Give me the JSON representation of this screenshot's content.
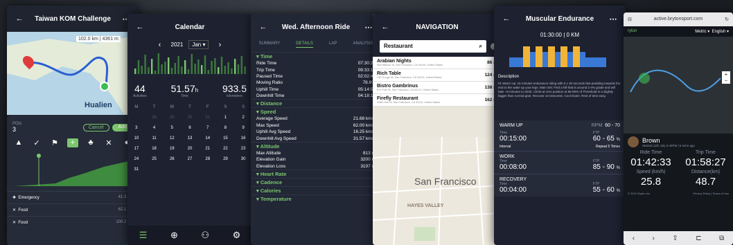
{
  "p1": {
    "title": "Taiwan KOM Challenge",
    "scale": "102.0 km",
    "elev": "4361 m",
    "place": "Hualien",
    "pois_label": "POIs",
    "pois_count": "3",
    "cancel": "Cancel",
    "add": "Add",
    "items": [
      {
        "label": "Emergency",
        "val": "41.3 km"
      },
      {
        "label": "Food",
        "val": "62.1 km"
      },
      {
        "label": "Food",
        "val": "100.2 km"
      }
    ]
  },
  "p2": {
    "title": "Calendar",
    "year": "2021",
    "month": "Jan",
    "stats": [
      {
        "v": "44",
        "l": "Activities"
      },
      {
        "v": "51.57",
        "u": "h",
        "l": "Time"
      },
      {
        "v": "933.5",
        "l": "kilometers"
      }
    ],
    "weekdays": [
      "M",
      "T",
      "W",
      "T",
      "F",
      "S",
      "S"
    ],
    "days": [
      "",
      "28",
      "29",
      "30",
      "31",
      "1",
      "2",
      "3",
      "4",
      "5",
      "6",
      "7",
      "8",
      "9",
      "10",
      "11",
      "12",
      "13",
      "14",
      "15",
      "16",
      "17",
      "18",
      "19",
      "20",
      "21",
      "22",
      "23",
      "24",
      "25",
      "26",
      "27",
      "28",
      "29",
      "30",
      "31"
    ]
  },
  "p3": {
    "title": "Wed. Afternoon Ride",
    "tabs": [
      "SUMMARY",
      "DETAILS",
      "LAP",
      "ANALYSIS"
    ],
    "sections": [
      {
        "name": "Time",
        "rows": [
          [
            "Ride Time",
            "07:30:25"
          ],
          [
            "Trip Time",
            "09:33:18"
          ],
          [
            "Paused Time",
            "02:02:43"
          ],
          [
            "Moving Ratio",
            "78.6%"
          ],
          [
            "Uphill Time",
            "05:14:57"
          ],
          [
            "Downhill Time",
            "04:18:10"
          ]
        ]
      },
      {
        "name": "Distance",
        "rows": []
      },
      {
        "name": "Speed",
        "rows": [
          [
            "Average Speed",
            "21.68 km/h"
          ],
          [
            "Max Speed",
            "62.00 km/h"
          ],
          [
            "Uphill Avg Speed",
            "16.25 km/h"
          ],
          [
            "Downhill Avg Speed",
            "31.57 km/h"
          ]
        ]
      },
      {
        "name": "Altitude",
        "rows": [
          [
            "Max Altitude",
            "813 m"
          ],
          [
            "Elevation Gain",
            "3200 m"
          ],
          [
            "Elevation Loss",
            "3197 m"
          ]
        ]
      },
      {
        "name": "Heart Rate",
        "rows": []
      },
      {
        "name": "Cadence",
        "rows": []
      },
      {
        "name": "Calories",
        "rows": []
      },
      {
        "name": "Temperature",
        "rows": []
      }
    ]
  },
  "p4": {
    "title": "NAVIGATION",
    "search": "Restaurant",
    "results": [
      {
        "name": "Arabian Nights",
        "addr": "555 Mission St, San Francisco, CA 94105, United States",
        "dist": "86 m"
      },
      {
        "name": "Rich Table",
        "addr": "199 Gough St, San Francisco, CA 94102, United States",
        "dist": "124 m"
      },
      {
        "name": "Bistro Gambrinus",
        "addr": "871 Polk St, San Francisco, CA 94117, United States",
        "dist": "138 m"
      },
      {
        "name": "Firefly Restaurant",
        "addr": "4288 24th St, San Francisco, CA 94114, United States",
        "dist": "162 m"
      }
    ],
    "city": "San Francisco",
    "district": "HAYES VALLEY"
  },
  "p5": {
    "title": "Muscular Endurance",
    "summary": "01:30:00 | 0 KM",
    "desc_label": "Description",
    "desc": "#1 Warm Up: 15 minutes endurance riding with 5 x 30 seconds fast pedaling towards the end to the wake up your legs. Main Set: Find a hill that is around 2-4% grade and will take ~8 minutes to climb. Climb at zero position at 85-90% of Threshold in a slightly bigger than normal gear. Recover on Descents. Cool Down: Rest of time easy.",
    "warm": {
      "label": "WARM UP",
      "rpm": "RPM",
      "rpm_v": "60 - 70",
      "time_label": "Time",
      "time": "00:15:00",
      "ftp_label": "FTP",
      "ftp": "60 - 65",
      "unit": "%"
    },
    "interval": "Interval",
    "repeat": "Repeat",
    "repeat_n": "5",
    "times": "Times",
    "work": {
      "label": "WORK",
      "time_label": "Time",
      "time": "00:08:00",
      "ftp_label": "FTP",
      "ftp": "85 - 90",
      "unit": "%"
    },
    "recovery": {
      "label": "RECOVERY",
      "time_label": "Time",
      "time": "00:04:00",
      "ftp_label": "FTP",
      "ftp": "55 - 60",
      "unit": "%"
    }
  },
  "p6": {
    "url": "active.brytonsport.com",
    "brand": "ryton",
    "metric": "Metric",
    "lang": "English",
    "name": "Brown",
    "started": "Started 11th July 5:45PM |",
    "ago": "6 mins ago",
    "ride_l": "Ride Time",
    "ride": "01:42:33",
    "trip_l": "Trip Time",
    "trip": "01:58:27",
    "speed_l": "Speed (km/h)",
    "speed": "25.8",
    "dist_l": "Distance(km)",
    "dist": "48.7",
    "copy": "© 2021 Bryton Inc.",
    "links": "Privacy Policy | Terms of Use"
  }
}
